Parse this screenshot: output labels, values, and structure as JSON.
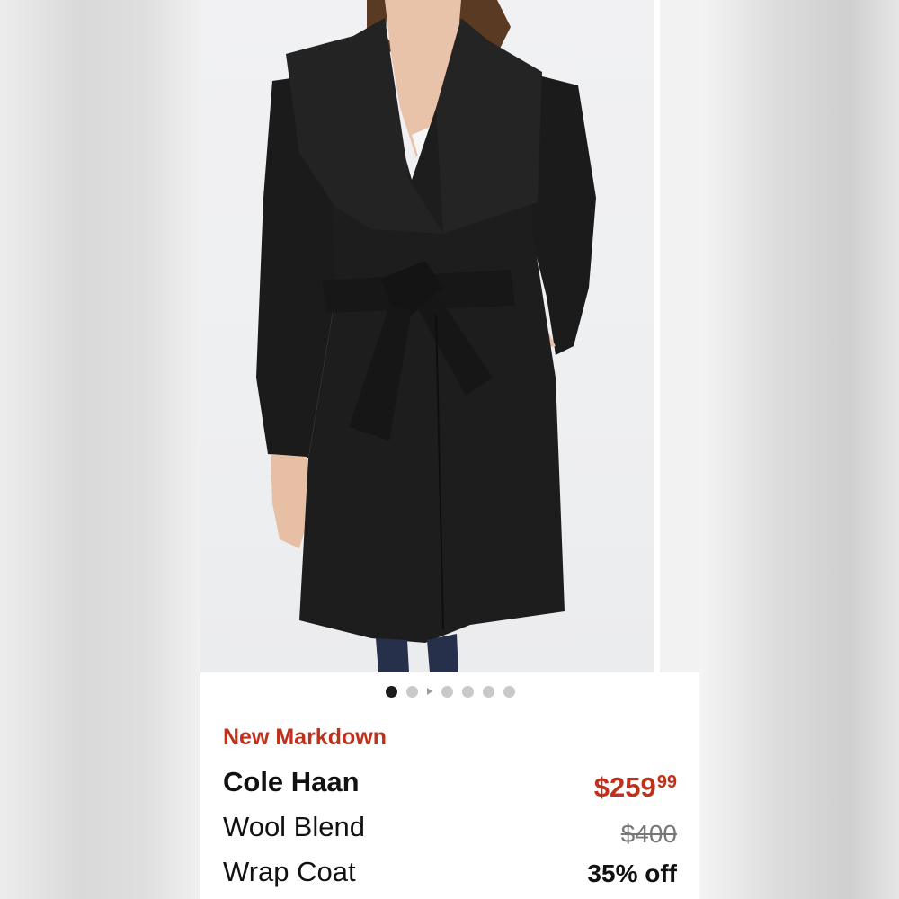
{
  "product": {
    "badge": "New Markdown",
    "brand": "Cole Haan",
    "name_line1": "Wool Blend",
    "name_line2": "Wrap Coat",
    "image_alt": "Black wool blend wrap coat with belt"
  },
  "pricing": {
    "currency_symbol": "$",
    "price_dollars": "259",
    "price_cents": "99",
    "original_price": "$400",
    "discount": "35% off"
  },
  "carousel": {
    "total_images": 7,
    "active_index": 0
  },
  "colors": {
    "accent": "#c1301b",
    "coat": "#1a1a1a"
  }
}
